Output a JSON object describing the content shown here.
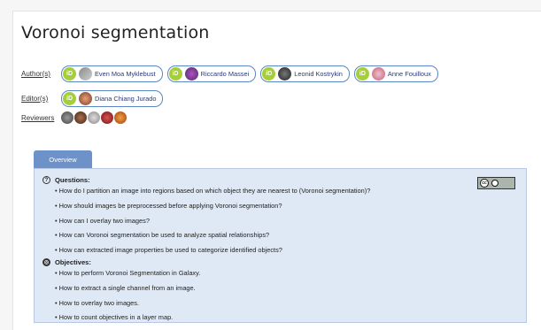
{
  "title": "Voronoi segmentation",
  "authors_label": "Author(s)",
  "editors_label": "Editor(s)",
  "reviewers_label": "Reviewers",
  "orcid_text": "iD",
  "authors": [
    {
      "name": "Even Moa Myklebust"
    },
    {
      "name": "Riccardo Massei"
    },
    {
      "name": "Leonid Kostrykin"
    },
    {
      "name": "Anne Fouilloux"
    }
  ],
  "editors": [
    {
      "name": "Diana Chiang Jurado"
    }
  ],
  "reviewers_count": 5,
  "overview_tab": "Overview",
  "license_badge": {
    "cc": "cc",
    "by": "BY"
  },
  "questions_heading": "Questions:",
  "questions": [
    "How do I partition an image into regions based on which object they are nearest to (Voronoi segmentation)?",
    "How should images be preprocessed before applying Voronoi segmentation?",
    "How can I overlay two images?",
    "How can Voronoi segmentation be used to analyze spatial relationships?",
    "How can extracted image properties be used to categorize identified objects?"
  ],
  "objectives_heading": "Objectives:",
  "objectives": [
    "How to perform Voronoi Segmentation in Galaxy.",
    "How to extract a single channel from an image.",
    "How to overlay two images.",
    "How to count objectives in a layer map."
  ],
  "colors": {
    "accent": "#6d92c9",
    "panel": "#dfe8f5",
    "orcid": "#a6ce39"
  }
}
